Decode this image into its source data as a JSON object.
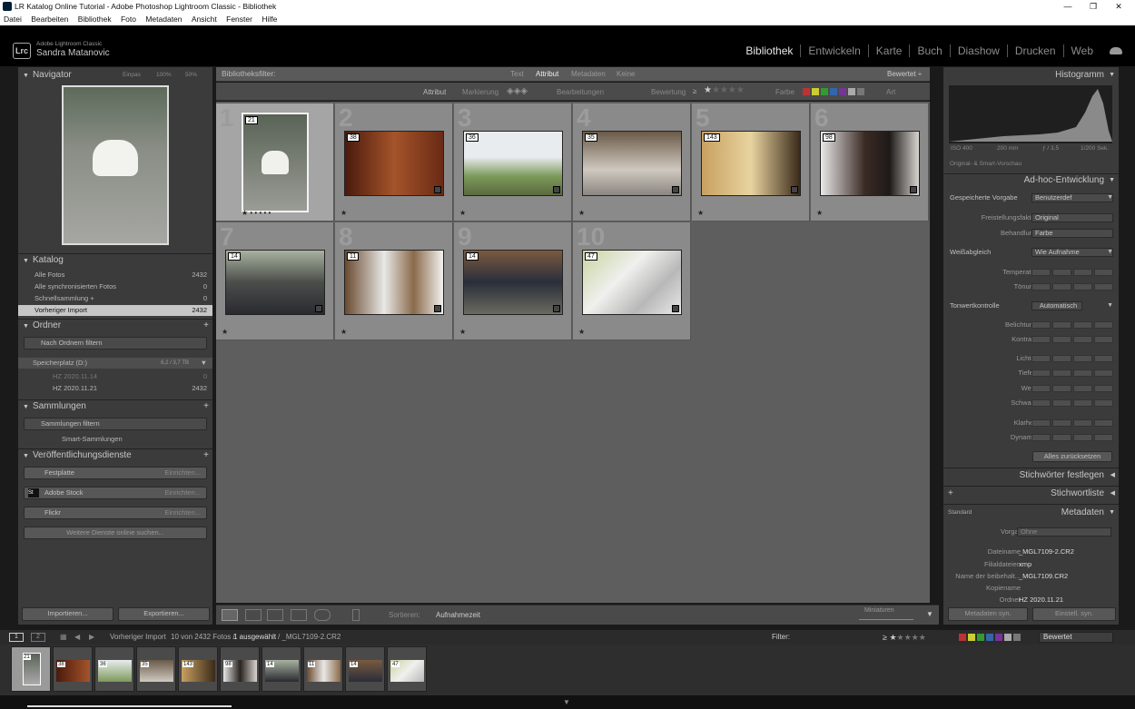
{
  "window": {
    "title": "LR Katalog Online Tutorial - Adobe Photoshop Lightroom Classic - Bibliothek",
    "controls": [
      "—",
      "❐",
      "✕"
    ]
  },
  "menu": [
    "Datei",
    "Bearbeiten",
    "Bibliothek",
    "Foto",
    "Metadaten",
    "Ansicht",
    "Fenster",
    "Hilfe"
  ],
  "identity": {
    "logo": "Lrc",
    "line1": "Adobe Lightroom Classic",
    "line2": "Sandra Matanovic"
  },
  "modules": [
    "Bibliothek",
    "Entwickeln",
    "Karte",
    "Buch",
    "Diashow",
    "Drucken",
    "Web"
  ],
  "navigator": {
    "title": "Navigator",
    "zoom": [
      "Einpas",
      "100%",
      "50%"
    ]
  },
  "catalog": {
    "title": "Katalog",
    "rows": [
      {
        "label": "Alle Fotos",
        "count": "2432"
      },
      {
        "label": "Alle synchronisierten Fotos",
        "count": "0"
      },
      {
        "label": "Schnellsammlung +",
        "count": "0"
      },
      {
        "label": "Vorheriger Import",
        "count": "2432"
      }
    ]
  },
  "folders": {
    "title": "Ordner",
    "filter": "Nach Ordnern filtern",
    "volume": "Speicherplatz (D:)",
    "volume_size": "6,2 / 3,7 TB",
    "items": [
      {
        "label": "HZ 2020.11.14",
        "count": "0"
      },
      {
        "label": "HZ 2020.11.21",
        "count": "2432"
      }
    ]
  },
  "collections": {
    "title": "Sammlungen",
    "filter": "Sammlungen filtern",
    "smart": "Smart-Sammlungen"
  },
  "publish": {
    "title": "Veröffentlichungsdienste",
    "services": [
      {
        "name": "Festplatte",
        "action": "Einrichten..."
      },
      {
        "name": "Adobe Stock",
        "action": "Einrichten...",
        "icon": "St"
      },
      {
        "name": "Flickr",
        "action": "Einrichten..."
      }
    ],
    "more": "Weitere Dienste online suchen..."
  },
  "left_buttons": {
    "import": "Importieren...",
    "export": "Exportieren..."
  },
  "filterbar": {
    "label": "Bibliotheksfilter:",
    "tabs": [
      "Text",
      "Attribut",
      "Metadaten",
      "Keine"
    ],
    "preset": "Bewertet ÷"
  },
  "attrbar": {
    "label": "Attribut",
    "flag": "Markierung",
    "edits": "Bearbeitungen",
    "rating": "Bewertung",
    "rating_op": "≥",
    "color": "Farbe",
    "kind": "Art"
  },
  "grid": [
    {
      "num": "1",
      "badge": "21",
      "stars": "★ • • • • •"
    },
    {
      "num": "2",
      "badge": "38",
      "stars": "★"
    },
    {
      "num": "3",
      "badge": "36",
      "stars": "★"
    },
    {
      "num": "4",
      "badge": "35",
      "stars": "★"
    },
    {
      "num": "5",
      "badge": "143",
      "stars": "★"
    },
    {
      "num": "6",
      "badge": "98",
      "stars": "★"
    },
    {
      "num": "7",
      "badge": "14",
      "stars": "★"
    },
    {
      "num": "8",
      "badge": "11",
      "stars": "★"
    },
    {
      "num": "9",
      "badge": "14",
      "stars": "★"
    },
    {
      "num": "10",
      "badge": "47",
      "stars": "★"
    }
  ],
  "toolbar": {
    "sort_label": "Sortieren:",
    "sort_value": "Aufnahmezeit",
    "thumb_label": "Miniaturen"
  },
  "histogram": {
    "title": "Histogramm",
    "iso": "ISO 400",
    "focal": "200 mm",
    "aperture": "ƒ / 3,5",
    "shutter": "1/200 Sek.",
    "smart_preview": "Original- & Smart-Vorschau"
  },
  "quick_develop": {
    "title": "Ad-hoc-Entwicklung",
    "preset_label": "Gespeicherte Vorgabe",
    "preset_value": "Benutzerdef",
    "crop_label": "Freistellungsfaktor",
    "crop_value": "Original",
    "treat_label": "Behandlung",
    "treat_value": "Farbe",
    "wb_label": "Weißabgleich",
    "wb_value": "Wie Aufnahme",
    "temp": "Temperatur",
    "tint": "Tönung",
    "tone_label": "Tonwertkontrolle",
    "auto": "Automatisch",
    "sliders": [
      "Belichtung",
      "Kontrast",
      "Lichter",
      "Tiefen",
      "Weiß",
      "Schwarz",
      "Klarheit",
      "Dynamik"
    ],
    "reset": "Alles zurücksetzen"
  },
  "keywording": {
    "title": "Stichwörter festlegen"
  },
  "keyword_list": {
    "title": "Stichwortliste"
  },
  "metadata": {
    "title": "Metadaten",
    "set": "Standard",
    "preset_label": "Vorgabe",
    "preset_value": "Ohne",
    "rows": [
      {
        "label": "Dateiname",
        "value": "_MGL7109-2.CR2"
      },
      {
        "label": "Filialdateien",
        "value": "xmp"
      },
      {
        "label": "Name der beibehalt...",
        "value": "_MGL7109.CR2"
      },
      {
        "label": "Kopiename",
        "value": ""
      },
      {
        "label": "Ordner",
        "value": "HZ 2020.11.21"
      }
    ]
  },
  "right_buttons": {
    "sync_meta": "Metadaten syn.",
    "sync_settings": "Einstell. syn."
  },
  "filmstrip_bar": {
    "screens": [
      "1",
      "2"
    ],
    "source": "Vorheriger Import",
    "count": "10 von 2432 Fotos /",
    "selected": "1 ausgewählt",
    "file": "/ _MGL7109-2.CR2",
    "filter_label": "Filter:",
    "filter_value": "Bewertet"
  },
  "filmstrip": [
    "21",
    "38",
    "36",
    "35",
    "143",
    "98",
    "14",
    "11",
    "14",
    "47"
  ],
  "colors": {
    "panel": "#3b3b3b",
    "grid": "#5e5e5e",
    "cell": "#8a8a8a",
    "active_module": "#e6e6e6"
  }
}
